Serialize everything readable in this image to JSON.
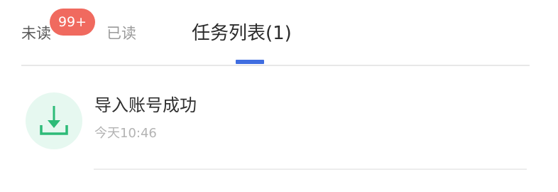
{
  "tabs": {
    "unread": {
      "label": "未读",
      "badge": "99+"
    },
    "read": {
      "label": "已读"
    },
    "tasks": {
      "label": "任务列表(1)",
      "active": true
    }
  },
  "colors": {
    "accent": "#3f6de0",
    "badge": "#f06a5f",
    "icon_bg": "#e6f8f0",
    "icon_fg": "#2dbb78"
  },
  "tasks": [
    {
      "icon": "download-icon",
      "title": "导入账号成功",
      "time": "今天10:46"
    }
  ]
}
